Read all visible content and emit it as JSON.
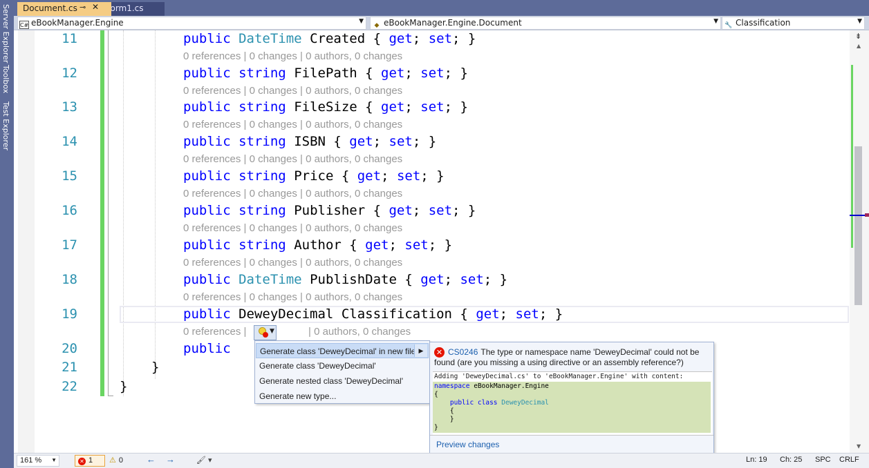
{
  "left_dock": [
    "Server Explorer",
    "Toolbox",
    "Test Explorer"
  ],
  "tabs": [
    {
      "label": "Document.cs",
      "active": true
    },
    {
      "label": "Form1.cs",
      "active": false
    }
  ],
  "nav": {
    "project": "eBookManager.Engine",
    "type": "eBookManager.Engine.Document",
    "member": "Classification"
  },
  "lens_text": "0 references | 0 changes | 0 authors, 0 changes",
  "lens_partial_left": "0 references |",
  "lens_partial_right": "| 0 authors, 0 changes",
  "code_lines": {
    "l11": {
      "num": "11",
      "kw": "public",
      "type": "DateTime",
      "name": "Created",
      "get": "get",
      "set": "set"
    },
    "l12": {
      "num": "12",
      "kw": "public",
      "type": "string",
      "name": "FilePath",
      "get": "get",
      "set": "set"
    },
    "l13": {
      "num": "13",
      "kw": "public",
      "type": "string",
      "name": "FileSize",
      "get": "get",
      "set": "set"
    },
    "l14": {
      "num": "14",
      "kw": "public",
      "type": "string",
      "name": "ISBN",
      "get": "get",
      "set": "set"
    },
    "l15": {
      "num": "15",
      "kw": "public",
      "type": "string",
      "name": "Price",
      "get": "get",
      "set": "set"
    },
    "l16": {
      "num": "16",
      "kw": "public",
      "type": "string",
      "name": "Publisher",
      "get": "get",
      "set": "set"
    },
    "l17": {
      "num": "17",
      "kw": "public",
      "type": "string",
      "name": "Author",
      "get": "get",
      "set": "set"
    },
    "l18": {
      "num": "18",
      "kw": "public",
      "type": "DateTime",
      "name": "PublishDate",
      "get": "get",
      "set": "set"
    },
    "l19": {
      "num": "19",
      "kw": "public",
      "type": "DeweyDecimal",
      "name": "Classification",
      "get": "get",
      "set": "set"
    },
    "l20": {
      "num": "20",
      "kw": "public"
    },
    "l21": {
      "num": "21",
      "brace": "}"
    },
    "l22": {
      "num": "22",
      "brace": "}"
    }
  },
  "quick_actions": {
    "items": [
      "Generate class 'DeweyDecimal' in new file",
      "Generate class 'DeweyDecimal'",
      "Generate nested class 'DeweyDecimal'",
      "Generate new type..."
    ],
    "selected_index": 0
  },
  "preview": {
    "error_code": "CS0246",
    "message": "The type or namespace name 'DeweyDecimal' could not be found (are you missing a using directive or an assembly reference?)",
    "header": "Adding 'DeweyDecimal.cs' to 'eBookManager.Engine' with content:",
    "code": {
      "ns_kw": "namespace",
      "ns_name": "eBookManager.Engine",
      "open_brace": "{",
      "class_kw": "public class",
      "class_name": "DeweyDecimal",
      "inner_open": "{",
      "inner_close": "}",
      "close_brace": "}"
    },
    "link": "Preview changes"
  },
  "status": {
    "zoom": "161 %",
    "errors": "1",
    "warnings": "0",
    "line": "Ln: 19",
    "col": "Ch: 25",
    "spacing": "SPC",
    "line_ending": "CRLF"
  },
  "colors": {
    "tab_active": "#f5cc84",
    "dock": "#5d6b99",
    "keyword": "#0000ff",
    "type": "#2b91af",
    "changed": "#6ad562",
    "error": "#e51400"
  }
}
